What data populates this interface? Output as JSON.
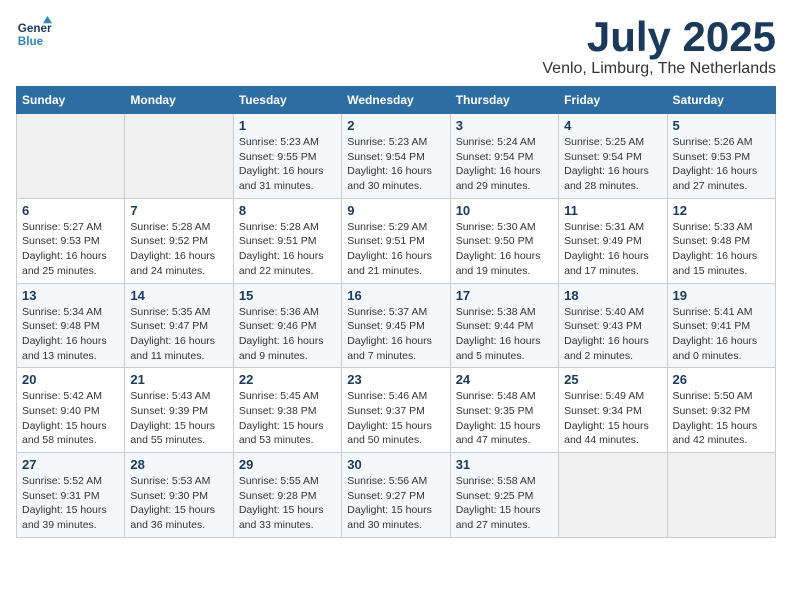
{
  "logo": {
    "line1": "General",
    "line2": "Blue"
  },
  "title": "July 2025",
  "location": "Venlo, Limburg, The Netherlands",
  "headers": [
    "Sunday",
    "Monday",
    "Tuesday",
    "Wednesday",
    "Thursday",
    "Friday",
    "Saturday"
  ],
  "weeks": [
    [
      {
        "day": "",
        "detail": ""
      },
      {
        "day": "",
        "detail": ""
      },
      {
        "day": "1",
        "detail": "Sunrise: 5:23 AM\nSunset: 9:55 PM\nDaylight: 16 hours and 31 minutes."
      },
      {
        "day": "2",
        "detail": "Sunrise: 5:23 AM\nSunset: 9:54 PM\nDaylight: 16 hours and 30 minutes."
      },
      {
        "day": "3",
        "detail": "Sunrise: 5:24 AM\nSunset: 9:54 PM\nDaylight: 16 hours and 29 minutes."
      },
      {
        "day": "4",
        "detail": "Sunrise: 5:25 AM\nSunset: 9:54 PM\nDaylight: 16 hours and 28 minutes."
      },
      {
        "day": "5",
        "detail": "Sunrise: 5:26 AM\nSunset: 9:53 PM\nDaylight: 16 hours and 27 minutes."
      }
    ],
    [
      {
        "day": "6",
        "detail": "Sunrise: 5:27 AM\nSunset: 9:53 PM\nDaylight: 16 hours and 25 minutes."
      },
      {
        "day": "7",
        "detail": "Sunrise: 5:28 AM\nSunset: 9:52 PM\nDaylight: 16 hours and 24 minutes."
      },
      {
        "day": "8",
        "detail": "Sunrise: 5:28 AM\nSunset: 9:51 PM\nDaylight: 16 hours and 22 minutes."
      },
      {
        "day": "9",
        "detail": "Sunrise: 5:29 AM\nSunset: 9:51 PM\nDaylight: 16 hours and 21 minutes."
      },
      {
        "day": "10",
        "detail": "Sunrise: 5:30 AM\nSunset: 9:50 PM\nDaylight: 16 hours and 19 minutes."
      },
      {
        "day": "11",
        "detail": "Sunrise: 5:31 AM\nSunset: 9:49 PM\nDaylight: 16 hours and 17 minutes."
      },
      {
        "day": "12",
        "detail": "Sunrise: 5:33 AM\nSunset: 9:48 PM\nDaylight: 16 hours and 15 minutes."
      }
    ],
    [
      {
        "day": "13",
        "detail": "Sunrise: 5:34 AM\nSunset: 9:48 PM\nDaylight: 16 hours and 13 minutes."
      },
      {
        "day": "14",
        "detail": "Sunrise: 5:35 AM\nSunset: 9:47 PM\nDaylight: 16 hours and 11 minutes."
      },
      {
        "day": "15",
        "detail": "Sunrise: 5:36 AM\nSunset: 9:46 PM\nDaylight: 16 hours and 9 minutes."
      },
      {
        "day": "16",
        "detail": "Sunrise: 5:37 AM\nSunset: 9:45 PM\nDaylight: 16 hours and 7 minutes."
      },
      {
        "day": "17",
        "detail": "Sunrise: 5:38 AM\nSunset: 9:44 PM\nDaylight: 16 hours and 5 minutes."
      },
      {
        "day": "18",
        "detail": "Sunrise: 5:40 AM\nSunset: 9:43 PM\nDaylight: 16 hours and 2 minutes."
      },
      {
        "day": "19",
        "detail": "Sunrise: 5:41 AM\nSunset: 9:41 PM\nDaylight: 16 hours and 0 minutes."
      }
    ],
    [
      {
        "day": "20",
        "detail": "Sunrise: 5:42 AM\nSunset: 9:40 PM\nDaylight: 15 hours and 58 minutes."
      },
      {
        "day": "21",
        "detail": "Sunrise: 5:43 AM\nSunset: 9:39 PM\nDaylight: 15 hours and 55 minutes."
      },
      {
        "day": "22",
        "detail": "Sunrise: 5:45 AM\nSunset: 9:38 PM\nDaylight: 15 hours and 53 minutes."
      },
      {
        "day": "23",
        "detail": "Sunrise: 5:46 AM\nSunset: 9:37 PM\nDaylight: 15 hours and 50 minutes."
      },
      {
        "day": "24",
        "detail": "Sunrise: 5:48 AM\nSunset: 9:35 PM\nDaylight: 15 hours and 47 minutes."
      },
      {
        "day": "25",
        "detail": "Sunrise: 5:49 AM\nSunset: 9:34 PM\nDaylight: 15 hours and 44 minutes."
      },
      {
        "day": "26",
        "detail": "Sunrise: 5:50 AM\nSunset: 9:32 PM\nDaylight: 15 hours and 42 minutes."
      }
    ],
    [
      {
        "day": "27",
        "detail": "Sunrise: 5:52 AM\nSunset: 9:31 PM\nDaylight: 15 hours and 39 minutes."
      },
      {
        "day": "28",
        "detail": "Sunrise: 5:53 AM\nSunset: 9:30 PM\nDaylight: 15 hours and 36 minutes."
      },
      {
        "day": "29",
        "detail": "Sunrise: 5:55 AM\nSunset: 9:28 PM\nDaylight: 15 hours and 33 minutes."
      },
      {
        "day": "30",
        "detail": "Sunrise: 5:56 AM\nSunset: 9:27 PM\nDaylight: 15 hours and 30 minutes."
      },
      {
        "day": "31",
        "detail": "Sunrise: 5:58 AM\nSunset: 9:25 PM\nDaylight: 15 hours and 27 minutes."
      },
      {
        "day": "",
        "detail": ""
      },
      {
        "day": "",
        "detail": ""
      }
    ]
  ]
}
